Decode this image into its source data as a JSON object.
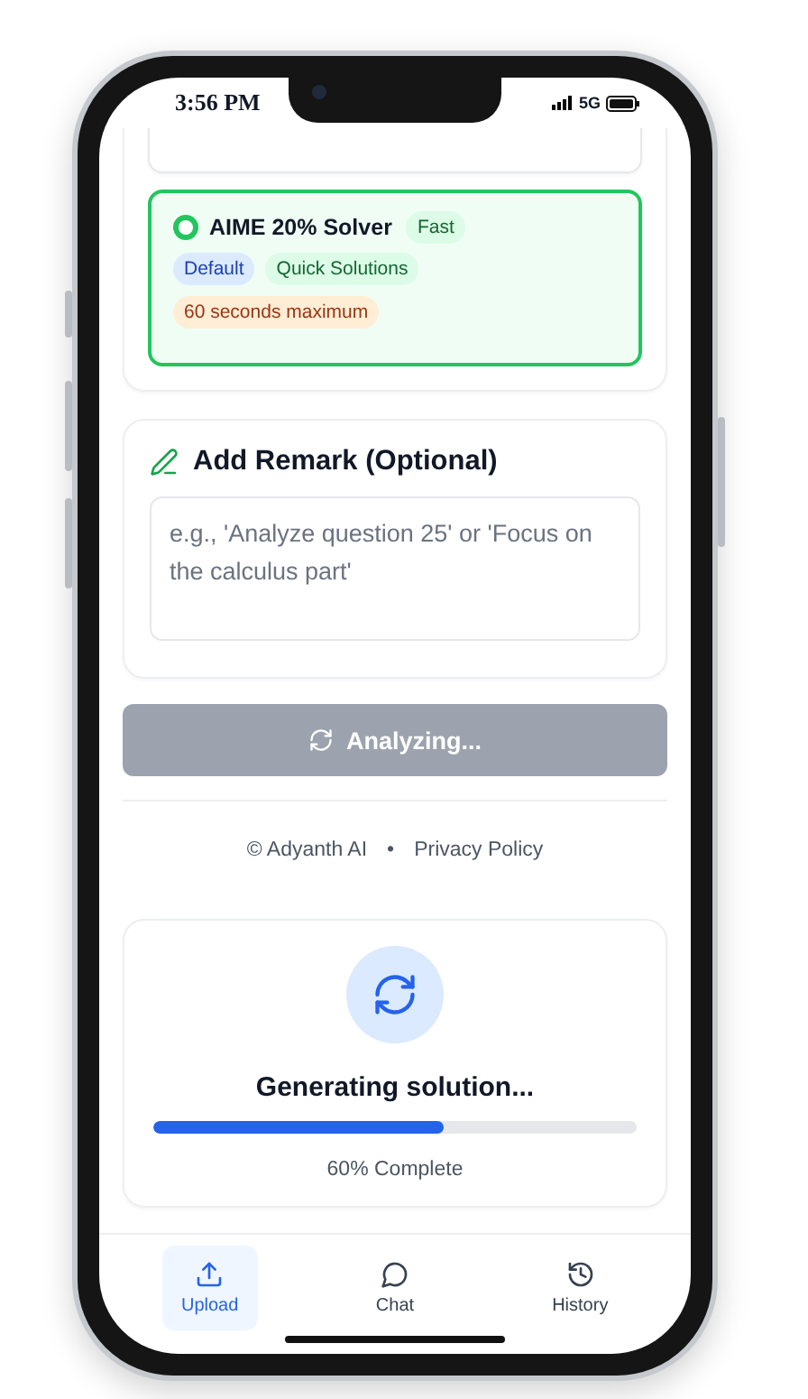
{
  "status_bar": {
    "time": "3:56 PM",
    "network": "5G"
  },
  "solver_option": {
    "title": "AIME 20% Solver",
    "selected": true,
    "badge": {
      "label": "Fast",
      "kind": "feature"
    },
    "tags": [
      {
        "label": "Default",
        "kind": "default"
      },
      {
        "label": "Quick Solutions",
        "kind": "feature"
      },
      {
        "label": "60 seconds maximum",
        "kind": "limit"
      }
    ]
  },
  "remark": {
    "title": "Add Remark (Optional)",
    "placeholder": "e.g., 'Analyze question 25' or 'Focus on the calculus part'"
  },
  "analyze_button": {
    "label": "Analyzing...",
    "disabled": true
  },
  "footer": {
    "copyright": "© Adyanth AI",
    "separator": "•",
    "link": "Privacy Policy"
  },
  "progress": {
    "title": "Generating solution...",
    "level": 0.6,
    "reading": "60% Complete"
  },
  "nav": [
    {
      "label": "Upload",
      "kind": "upload",
      "selected": true
    },
    {
      "label": "Chat",
      "kind": "chat",
      "selected": false
    },
    {
      "label": "History",
      "kind": "history",
      "selected": false
    }
  ]
}
